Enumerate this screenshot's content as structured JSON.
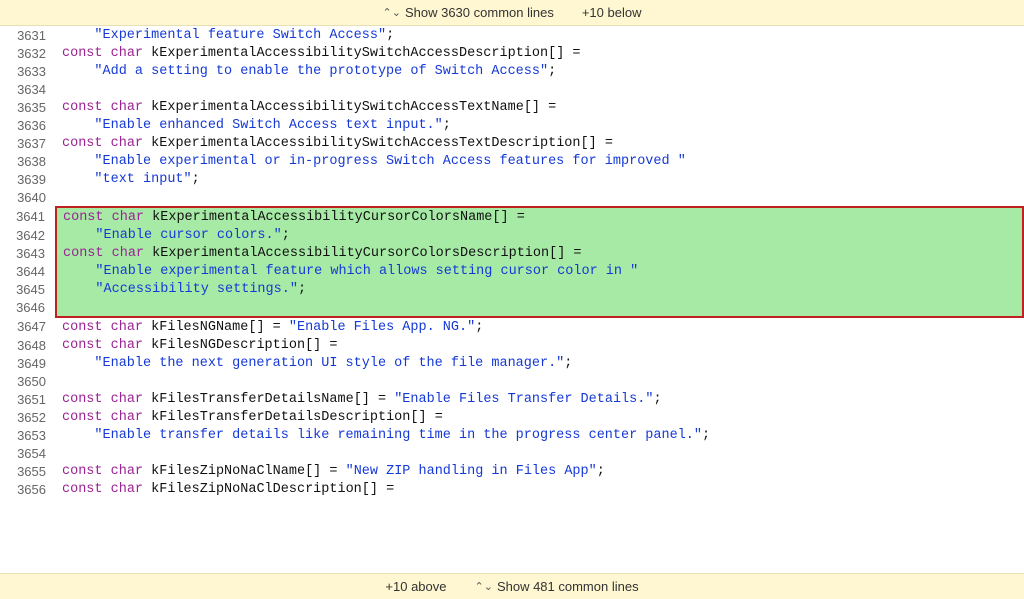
{
  "topbar": {
    "show_common": "Show 3630 common lines",
    "show_more": "+10 below"
  },
  "bottombar": {
    "show_more": "+10 above",
    "show_common": "Show 481 common lines"
  },
  "gutter": {
    "start": 3631,
    "end": 3656
  },
  "tokens": {
    "const": "const",
    "char": "char"
  },
  "code": {
    "l3631": {
      "indent": "    ",
      "str1": "\"Experimental feature Switch Access\"",
      "tail": ";"
    },
    "l3632": {
      "id": "kExperimentalAccessibilitySwitchAccessDescription",
      "brackets": "[]",
      "eq": " ="
    },
    "l3633": {
      "indent": "    ",
      "str1": "\"Add a setting to enable the prototype of Switch Access\"",
      "tail": ";"
    },
    "l3634": {
      "blank": ""
    },
    "l3635": {
      "id": "kExperimentalAccessibilitySwitchAccessTextName",
      "brackets": "[]",
      "eq": " ="
    },
    "l3636": {
      "indent": "    ",
      "str1": "\"Enable enhanced Switch Access text input.\"",
      "tail": ";"
    },
    "l3637": {
      "id": "kExperimentalAccessibilitySwitchAccessTextDescription",
      "brackets": "[]",
      "eq": " ="
    },
    "l3638": {
      "indent": "    ",
      "str1": "\"Enable experimental or in-progress Switch Access features for improved \""
    },
    "l3639": {
      "indent": "    ",
      "str1": "\"text input\"",
      "tail": ";"
    },
    "l3640": {
      "blank": ""
    },
    "l3641": {
      "id": "kExperimentalAccessibilityCursorColorsName",
      "brackets": "[]",
      "eq": " ="
    },
    "l3642": {
      "indent": "    ",
      "str1": "\"Enable cursor colors.\"",
      "tail": ";"
    },
    "l3643": {
      "id": "kExperimentalAccessibilityCursorColorsDescription",
      "brackets": "[]",
      "eq": " ="
    },
    "l3644": {
      "indent": "    ",
      "str1": "\"Enable experimental feature which allows setting cursor color in \""
    },
    "l3645": {
      "indent": "    ",
      "str1": "\"Accessibility settings.\"",
      "tail": ";"
    },
    "l3646": {
      "blank": ""
    },
    "l3647": {
      "id": "kFilesNGName",
      "brackets": "[]",
      "eq": " = ",
      "inline_str": "\"Enable Files App. NG.\"",
      "tail": ";"
    },
    "l3648": {
      "id": "kFilesNGDescription",
      "brackets": "[]",
      "eq": " ="
    },
    "l3649": {
      "indent": "    ",
      "str1": "\"Enable the next generation UI style of the file manager.\"",
      "tail": ";"
    },
    "l3650": {
      "blank": ""
    },
    "l3651": {
      "id": "kFilesTransferDetailsName",
      "brackets": "[]",
      "eq": " = ",
      "inline_str": "\"Enable Files Transfer Details.\"",
      "tail": ";"
    },
    "l3652": {
      "id": "kFilesTransferDetailsDescription",
      "brackets": "[]",
      "eq": " ="
    },
    "l3653": {
      "indent": "    ",
      "str1": "\"Enable transfer details like remaining time in the progress center panel.\"",
      "tail": ";"
    },
    "l3654": {
      "blank": ""
    },
    "l3655": {
      "id": "kFilesZipNoNaClName",
      "brackets": "[]",
      "eq": " = ",
      "inline_str": "\"New ZIP handling in Files App\"",
      "tail": ";"
    },
    "l3656": {
      "id": "kFilesZipNoNaClDescription",
      "brackets": "[]",
      "eq": " ="
    }
  },
  "highlight": {
    "start": 3641,
    "end": 3646
  }
}
